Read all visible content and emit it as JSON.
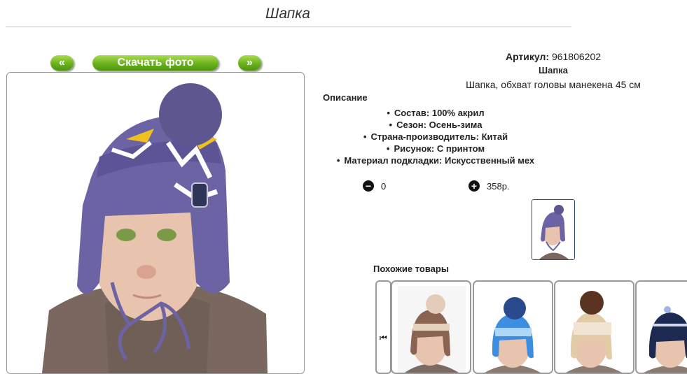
{
  "page": {
    "title": "Шапка"
  },
  "photo_nav": {
    "prev_label": "«",
    "download_label": "Скачать фото",
    "next_label": "»"
  },
  "product": {
    "sku_label": "Артикул:",
    "sku_value": "961806202",
    "name": "Шапка",
    "description": "Шапка, обхват головы манекена 45 см",
    "details_heading": "Описание",
    "specs": [
      "Состав: 100% акрил",
      "Сезон: Осень-зима",
      "Страна-производитель: Китай",
      "Рисунок: С принтом",
      "Материал подкладки: Искусственный мех"
    ]
  },
  "cart": {
    "quantity": "0",
    "price": "358р.",
    "minus_symbol": "−",
    "plus_symbol": "+"
  },
  "similar": {
    "heading": "Похожие товары",
    "scroll_symbol": "⏮"
  },
  "colors": {
    "accent_green": "#6bb11c",
    "hat_purple": "#6c63a4",
    "thumb_border": "#2b4a7a"
  }
}
